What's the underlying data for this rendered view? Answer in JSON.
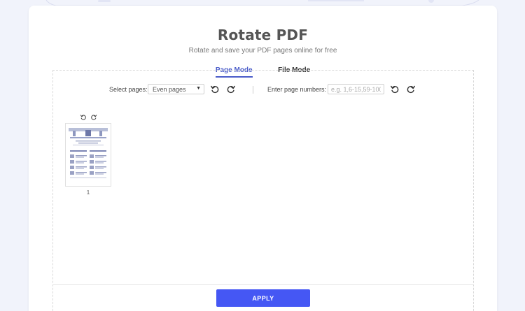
{
  "header": {
    "title": "Rotate PDF",
    "subtitle": "Rotate and save your PDF pages online for free"
  },
  "tabs": [
    {
      "label": "Page Mode",
      "active": true
    },
    {
      "label": "File Mode",
      "active": false
    }
  ],
  "toolbar": {
    "select_label": "Select pages:",
    "select_value": "Even pages",
    "rotate_left_icon": "rotate-left-icon",
    "rotate_right_icon": "rotate-right-icon",
    "page_numbers_label": "Enter page numbers:",
    "page_numbers_placeholder": "e.g. 1,6-15,59-100."
  },
  "pages": [
    {
      "number": "1"
    }
  ],
  "footer": {
    "apply_label": "APPLY"
  },
  "colors": {
    "accent": "#4557f4",
    "active_tab": "#4a5cc9",
    "background": "#f1f3fb"
  }
}
